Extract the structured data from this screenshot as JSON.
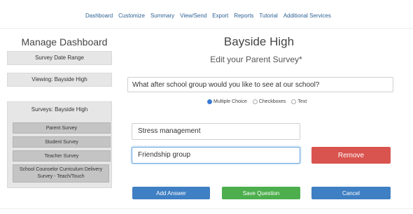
{
  "nav": {
    "items": [
      "Dashboard",
      "Customize",
      "Summary",
      "View/Send",
      "Export",
      "Reports",
      "Tutorial",
      "Additional Services"
    ]
  },
  "sidebar": {
    "title": "Manage Dashboard",
    "date_range": "Survey Date Range",
    "viewing": "Viewing: Bayside High",
    "surveys_header": "Surveys: Bayside High",
    "surveys": [
      "Parent Survey",
      "Student Survey",
      "Teacher Survey",
      "School Counselor Curriculum Delivery Survey - Teach/Touch"
    ]
  },
  "main": {
    "title": "Bayside High",
    "subtitle": "Edit your Parent Survey*",
    "question_value": "What after school group would you like to see at our school?",
    "types": {
      "multiple_choice": "Multiple Choice",
      "checkboxes": "Checkboxes",
      "text": "Text",
      "selected": "Multiple Choice"
    },
    "answers": [
      "Stress management",
      "Friendship group"
    ],
    "remove_label": "Remove",
    "add_answer_label": "Add Answer",
    "save_label": "Save Question",
    "cancel_label": "Cancel"
  },
  "colors": {
    "nav_link": "#2b5f93",
    "remove": "#d9534f",
    "primary": "#3f7fc3",
    "save": "#4cae4c"
  }
}
